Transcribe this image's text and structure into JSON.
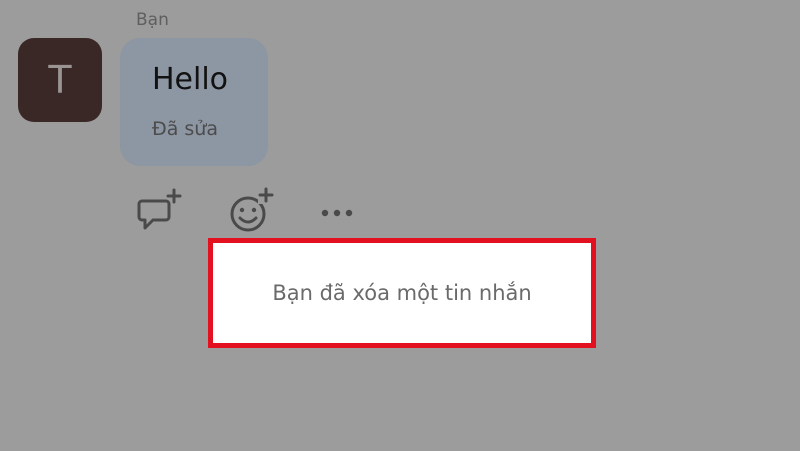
{
  "message": {
    "sender_name": "Bạn",
    "avatar_initial": "T",
    "text": "Hello",
    "edited_label": "Đã sửa"
  },
  "actions": [
    {
      "icon": "reply-add-icon"
    },
    {
      "icon": "react-add-icon"
    },
    {
      "icon": "more-icon"
    }
  ],
  "notice": {
    "text": "Bạn đã xóa một tin nhắn"
  },
  "colors": {
    "overlay_background": "#9c9c9c",
    "avatar_background": "#3a2826",
    "bubble_background": "#8d96a3",
    "highlight_border": "#e3101f"
  }
}
